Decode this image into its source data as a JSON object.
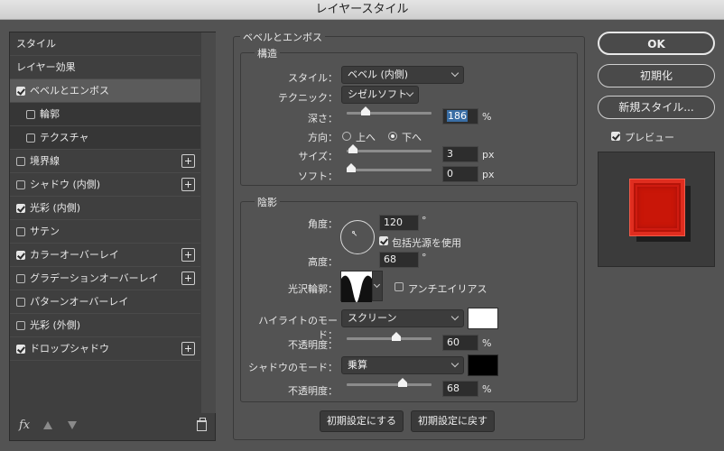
{
  "window": {
    "title": "レイヤースタイル"
  },
  "effects_list": [
    {
      "label": "スタイル",
      "checkbox": false,
      "checked": false,
      "plus": false
    },
    {
      "label": "レイヤー効果",
      "checkbox": false,
      "checked": false,
      "plus": false
    },
    {
      "label": "ベベルとエンボス",
      "checkbox": true,
      "checked": true,
      "plus": false,
      "selected": true
    },
    {
      "label": "輪郭",
      "checkbox": true,
      "checked": false,
      "plus": false,
      "sub": true
    },
    {
      "label": "テクスチャ",
      "checkbox": true,
      "checked": false,
      "plus": false,
      "sub": true
    },
    {
      "label": "境界線",
      "checkbox": true,
      "checked": false,
      "plus": true
    },
    {
      "label": "シャドウ (内側)",
      "checkbox": true,
      "checked": false,
      "plus": true
    },
    {
      "label": "光彩 (内側)",
      "checkbox": true,
      "checked": true,
      "plus": false
    },
    {
      "label": "サテン",
      "checkbox": true,
      "checked": false,
      "plus": false
    },
    {
      "label": "カラーオーバーレイ",
      "checkbox": true,
      "checked": true,
      "plus": true
    },
    {
      "label": "グラデーションオーバーレイ",
      "checkbox": true,
      "checked": false,
      "plus": true
    },
    {
      "label": "パターンオーバーレイ",
      "checkbox": true,
      "checked": false,
      "plus": false
    },
    {
      "label": "光彩 (外側)",
      "checkbox": true,
      "checked": false,
      "plus": false
    },
    {
      "label": "ドロップシャドウ",
      "checkbox": true,
      "checked": true,
      "plus": true
    }
  ],
  "left_footer": {
    "fx_label": "fx"
  },
  "bevel": {
    "section_title": "ベベルとエンボス",
    "structure": {
      "title": "構造",
      "style_label": "スタイル：",
      "style_value": "ベベル (内側)",
      "technique_label": "テクニック：",
      "technique_value": "シゼルソフト",
      "depth_label": "深さ：",
      "depth_value": "186",
      "depth_unit": "%",
      "direction_label": "方向：",
      "direction_up": "上へ",
      "direction_down": "下へ",
      "direction_selected": "down",
      "size_label": "サイズ：",
      "size_value": "3",
      "size_unit": "px",
      "soften_label": "ソフト：",
      "soften_value": "0",
      "soften_unit": "px"
    },
    "shading": {
      "title": "陰影",
      "angle_label": "角度：",
      "angle_value": "120",
      "angle_unit": "°",
      "global_light_label": "包括光源を使用",
      "global_light_checked": true,
      "altitude_label": "高度：",
      "altitude_value": "68",
      "altitude_unit": "°",
      "gloss_contour_label": "光沢輪郭：",
      "antialias_label": "アンチエイリアス",
      "antialias_checked": false,
      "highlight_mode_label": "ハイライトのモード：",
      "highlight_mode_value": "スクリーン",
      "highlight_color": "#ffffff",
      "highlight_opacity_label": "不透明度：",
      "highlight_opacity_value": "60",
      "highlight_opacity_unit": "%",
      "shadow_mode_label": "シャドウのモード：",
      "shadow_mode_value": "乗算",
      "shadow_color": "#000000",
      "shadow_opacity_label": "不透明度：",
      "shadow_opacity_value": "68",
      "shadow_opacity_unit": "%"
    },
    "make_default_label": "初期設定にする",
    "reset_default_label": "初期設定に戻す"
  },
  "right": {
    "ok_label": "OK",
    "reset_label": "初期化",
    "new_style_label": "新規スタイル...",
    "preview_label": "プレビュー",
    "preview_checked": true
  },
  "slider_levels": {
    "depth": 0.19,
    "size": 0.02,
    "soften": 0.0,
    "highlight_opacity": 0.6,
    "shadow_opacity": 0.68
  }
}
